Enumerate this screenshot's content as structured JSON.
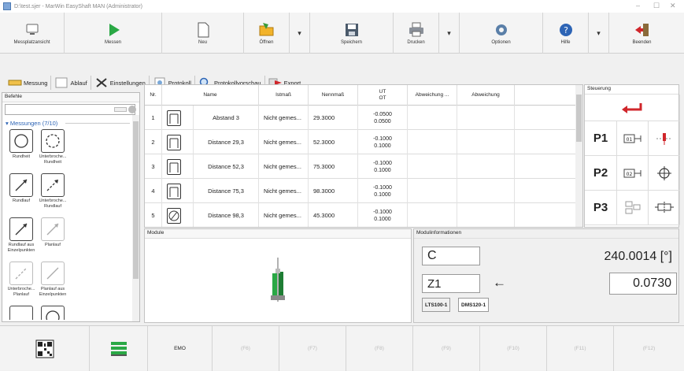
{
  "window": {
    "title": "D:\\test.sjer - MarWin EasyShaft MAN (Administrator)",
    "minimize": "–",
    "maximize": "☐",
    "close": "✕"
  },
  "toolbar": {
    "messplatz": "Messplatzansicht",
    "messen": "Messen",
    "neu": "Neu",
    "oeffnen": "Öffnen",
    "speichern": "Speichern",
    "drucken": "Drucken",
    "optionen": "Optionen",
    "hilfe": "Hilfe",
    "beenden": "Beenden",
    "dropdown": "▾"
  },
  "tabs": [
    "Messung",
    "Ablauf",
    "Einstellungen",
    "Protokoll",
    "Protokollvorschau",
    "Export"
  ],
  "befehle": {
    "header": "Befehle",
    "group": "Messungen (7/10)",
    "items": [
      [
        "Rundheit"
      ],
      [
        "Unterbroche...",
        "Rundheit"
      ],
      [
        "Rundlauf"
      ],
      [
        "Unterbroche...",
        "Rundlauf"
      ],
      [
        "Rundlauf aus",
        "Einzelpunkten"
      ],
      [
        "Planlauf"
      ],
      [
        "Unterbroche...",
        "Planlauf"
      ],
      [
        "Planlauf aus",
        "Einzelpunkten"
      ]
    ]
  },
  "table": {
    "headers": {
      "nr": "Nr.",
      "name": "Name",
      "istmass": "Istmaß",
      "nennmass": "Nennmaß",
      "ut": "UT",
      "ot": "OT",
      "abw1": "Abweichung ...",
      "abw2": "Abweichung"
    },
    "rows": [
      {
        "nr": "1",
        "name": "Abstand 3",
        "istmass": "Nicht gemes...",
        "nennmass": "29.3000",
        "ut": "-0.0500",
        "ot": "0.0500"
      },
      {
        "nr": "2",
        "name": "Distance 29,3",
        "istmass": "Nicht gemes...",
        "nennmass": "52.3000",
        "ut": "-0.1000",
        "ot": "0.1000"
      },
      {
        "nr": "3",
        "name": "Distance 52,3",
        "istmass": "Nicht gemes...",
        "nennmass": "75.3000",
        "ut": "-0.1000",
        "ot": "0.1000"
      },
      {
        "nr": "4",
        "name": "Distance 75,3",
        "istmass": "Nicht gemes...",
        "nennmass": "98.3000",
        "ut": "-0.1000",
        "ot": "0.1000"
      },
      {
        "nr": "5",
        "name": "Distance 98,3",
        "istmass": "Nicht gemes...",
        "nennmass": "45.3000",
        "ut": "-0.1000",
        "ot": "0.1000"
      }
    ]
  },
  "steuerung": {
    "header": "Steuerung",
    "p1": "P1",
    "p2": "P2",
    "p3": "P3",
    "badge1": "01",
    "badge2": "02"
  },
  "module": {
    "header": "Module"
  },
  "modulinfo": {
    "header": "Modulinformationen",
    "axis1": "C",
    "value1": "240.0014 [°]",
    "axis2": "Z1",
    "arrow": "←",
    "value2": "0.0730",
    "tab1": "LTS100-1",
    "tab2": "DMS120-1"
  },
  "fkeys": [
    "EMO",
    "(F6)",
    "(F7)",
    "(F8)",
    "(F9)",
    "(F10)",
    "(F11)",
    "(F12)"
  ],
  "colors": {
    "green": "#2aa845",
    "red": "#d0262b",
    "blue": "#2d64b5"
  }
}
